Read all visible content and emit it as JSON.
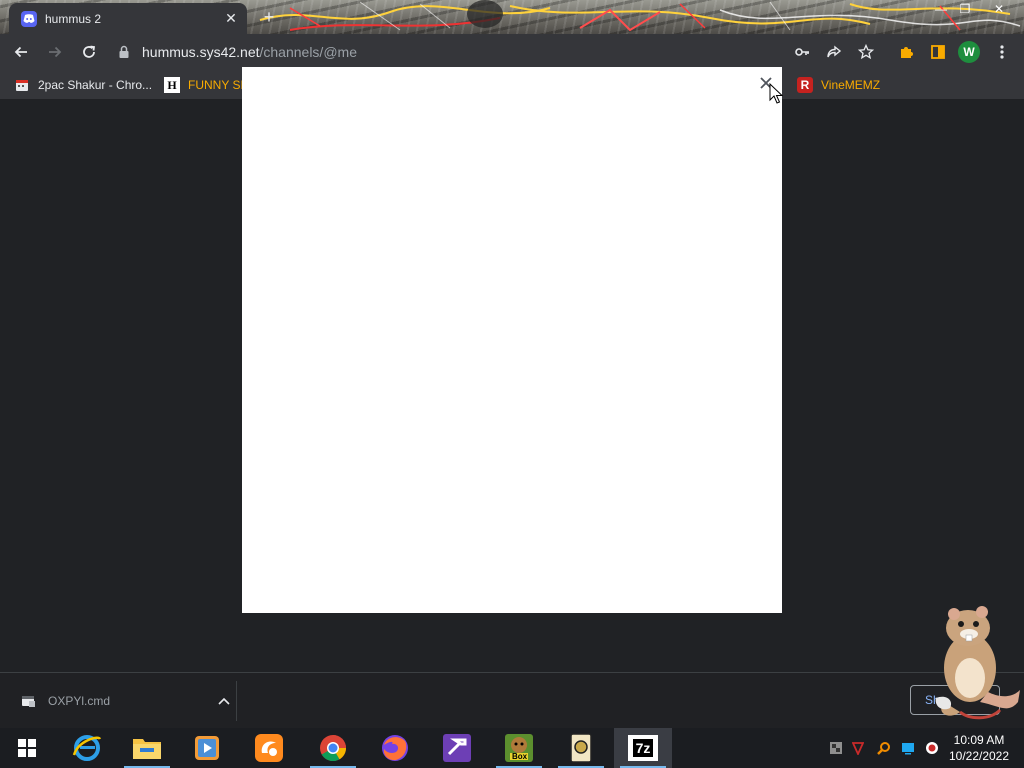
{
  "browser": {
    "tab": {
      "title": "hummus 2",
      "close_glyph": "✕"
    },
    "new_tab_glyph": "+",
    "window_controls": [
      "—",
      "❐",
      "✕"
    ],
    "url": {
      "host": "hummus.sys42.net",
      "path": "/channels/@me"
    },
    "profile_initial": "W",
    "bookmarks": [
      {
        "label": "2pac Shakur - Chro...",
        "icon": "calendar-icon"
      },
      {
        "label": "FUNNY SN",
        "icon_letter": "H"
      },
      {
        "label": "VineMEMZ",
        "icon_letter": "R"
      }
    ],
    "accent_color": "#5865f2"
  },
  "modal": {
    "close_glyph": "✕",
    "background": "#ffffff"
  },
  "downloads": {
    "file": {
      "name": "OXPYl.cmd"
    },
    "show_all_label": "Sh"
  },
  "taskbar": {
    "apps": [
      "internet-explorer",
      "file-explorer",
      "media-player",
      "uc-browser",
      "chrome",
      "firefox",
      "visual-studio",
      "bonzi-buddy",
      "app-icon",
      "7-zip"
    ],
    "seven_zip_label": "7z",
    "bonzi_label": "Box",
    "clock": {
      "time": "10:09 AM",
      "date": "10/22/2022"
    }
  }
}
